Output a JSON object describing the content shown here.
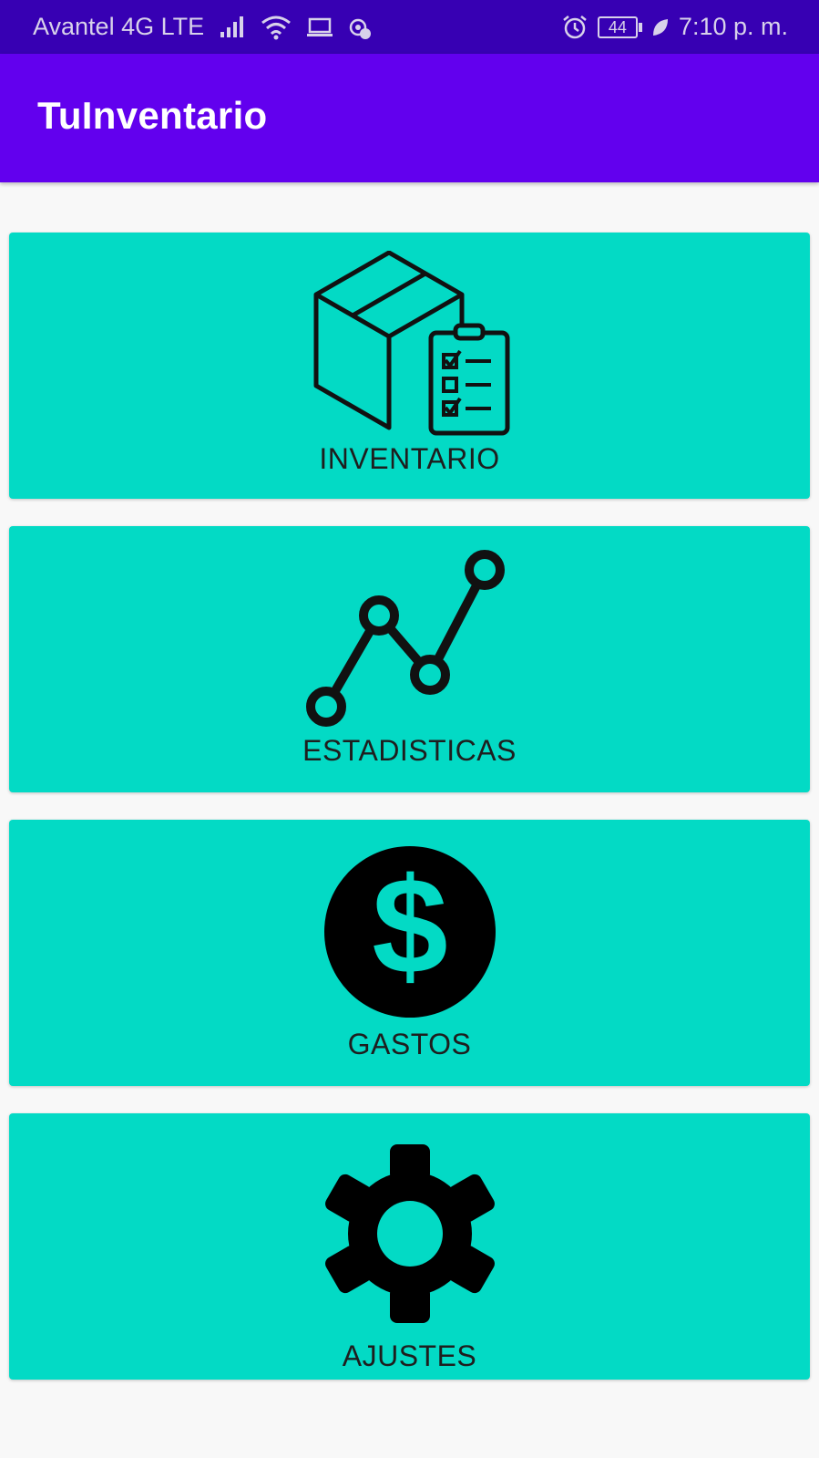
{
  "status_bar": {
    "carrier": "Avantel 4G LTE",
    "battery_level": "44",
    "time": "7:10 p. m.",
    "icons": [
      "signal-icon",
      "wifi-icon",
      "laptop-icon",
      "settings-badge-icon",
      "alarm-icon",
      "battery-icon",
      "leaf-icon"
    ]
  },
  "app_bar": {
    "title": "TuInventario",
    "color": "#6200ee"
  },
  "menu": {
    "accent_color": "#03dac5",
    "items": [
      {
        "label": "INVENTARIO",
        "icon": "inventory-box-clipboard-icon"
      },
      {
        "label": "ESTADISTICAS",
        "icon": "line-chart-icon"
      },
      {
        "label": "GASTOS",
        "icon": "dollar-coin-icon"
      },
      {
        "label": "AJUSTES",
        "icon": "gear-icon"
      }
    ]
  }
}
